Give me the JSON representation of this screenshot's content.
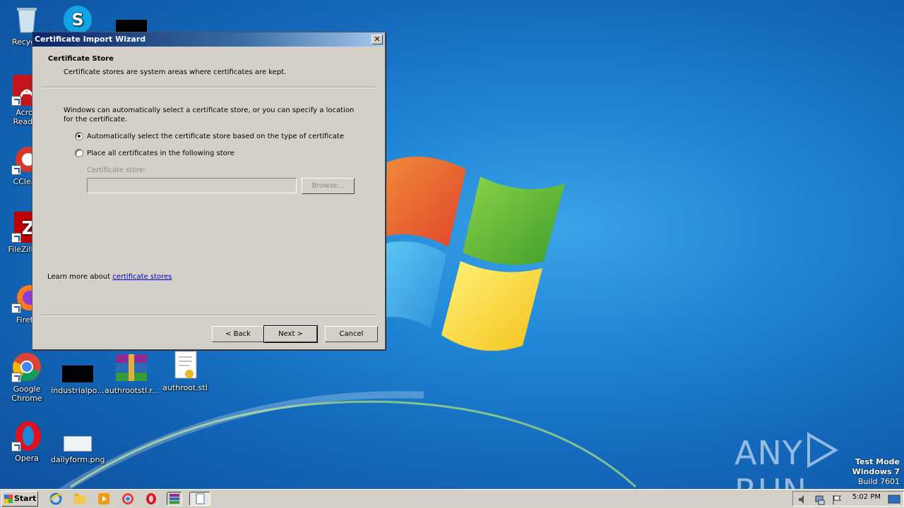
{
  "desktop": {
    "icons": [
      {
        "label": "Recycle"
      },
      {
        "label": "Acrob\nReader"
      },
      {
        "label": "CClean"
      },
      {
        "label": "FileZilla C"
      },
      {
        "label": "Firefo"
      },
      {
        "label": "Google\nChrome"
      },
      {
        "label": "Opera"
      },
      {
        "label": "industrialpo..."
      },
      {
        "label": "authrootstl.r..."
      },
      {
        "label": "authroot.stl"
      },
      {
        "label": "dailyform.png"
      }
    ]
  },
  "dialog": {
    "title": "Certificate Import Wizard",
    "close_label": "✕",
    "header_title": "Certificate Store",
    "header_subtitle": "Certificate stores are system areas where certificates are kept.",
    "description": "Windows can automatically select a certificate store, or you can specify a location for the certificate.",
    "option_auto": "Automatically select the certificate store based on the type of certificate",
    "option_manual": "Place all certificates in the following store",
    "store_label": "Certificate store:",
    "store_value": "",
    "browse_label": "Browse...",
    "learn_prefix": "Learn more about ",
    "learn_link": "certificate stores",
    "back_label": "< Back",
    "next_label": "Next >",
    "cancel_label": "Cancel",
    "selected_option": "auto"
  },
  "watermark": {
    "brand_left": "ANY",
    "brand_right": "RUN",
    "mode": "Test Mode",
    "os": "Windows 7",
    "build": "Build 7601"
  },
  "taskbar": {
    "start_label": "Start",
    "clock": "5:02 PM",
    "pinned": [
      "ie-icon",
      "explorer-icon",
      "media-player-icon",
      "chrome-icon",
      "opera-icon",
      "winrar-icon",
      "document-icon"
    ]
  },
  "colors": {
    "dialog_bg": "#d4d0c8",
    "titlebar": "#0a246a",
    "link": "#0000cc",
    "desktop": "#1f86d6"
  }
}
